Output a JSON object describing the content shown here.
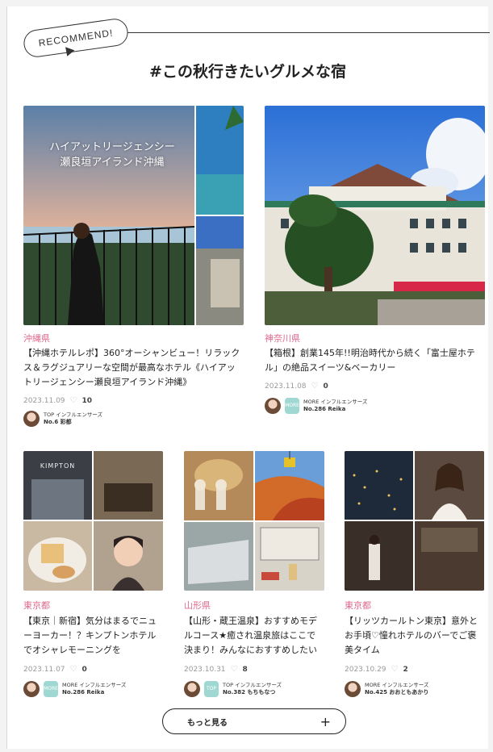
{
  "recommend_label": "RECOMMEND!",
  "section_title": "#この秋行きたいグルメな宿",
  "articles": [
    {
      "prefecture": "沖縄県",
      "title": "【沖縄ホテルレポ】360°オーシャンビュー！リラックス＆ラグジュアリーな空間が最高なホテル《ハイアットリージェンシー瀬良垣アイランド沖縄》",
      "date": "2023.11.09",
      "likes": "10",
      "author_group": "TOP インフルエンサーズ",
      "author_name": "No.6 彩都",
      "image_caption": "ハイアットリージェンシー\n瀬良垣アイランド沖縄"
    },
    {
      "prefecture": "神奈川県",
      "title": "【箱根】創業145年!!明治時代から続く「富士屋ホテル」の絶品スイーツ&ベーカリー",
      "date": "2023.11.08",
      "likes": "0",
      "author_group": "MORE インフルエンサーズ",
      "author_name": "No.286 Reika"
    },
    {
      "prefecture": "東京都",
      "title": "【東京｜新宿】気分はまるでニューヨーカー！？キンプトンホテルでオシャレモーニングを",
      "date": "2023.11.07",
      "likes": "0",
      "author_group": "MORE インフルエンサーズ",
      "author_name": "No.286 Reika",
      "image_caption": "KIMPTON"
    },
    {
      "prefecture": "山形県",
      "title": "【山形・蔵王温泉】おすすめモデルコース★癒され温泉旅はここで決まり！みんなにおすすめしたい蔵王…",
      "date": "2023.10.31",
      "likes": "8",
      "author_group": "TOP インフルエンサーズ",
      "author_name": "No.382 もちもなつ"
    },
    {
      "prefecture": "東京都",
      "title": "【リッツカールトン東京】意外とお手頃♡憧れホテルのバーでご褒美タイム",
      "date": "2023.10.29",
      "likes": "2",
      "author_group": "MORE インフルエンサーズ",
      "author_name": "No.425 おおともあかり"
    }
  ],
  "more_button": {
    "label": "もっと見る",
    "icon": "+"
  },
  "colors": {
    "prefecture": "#e06a8e",
    "accent": "#9fd8d2"
  }
}
